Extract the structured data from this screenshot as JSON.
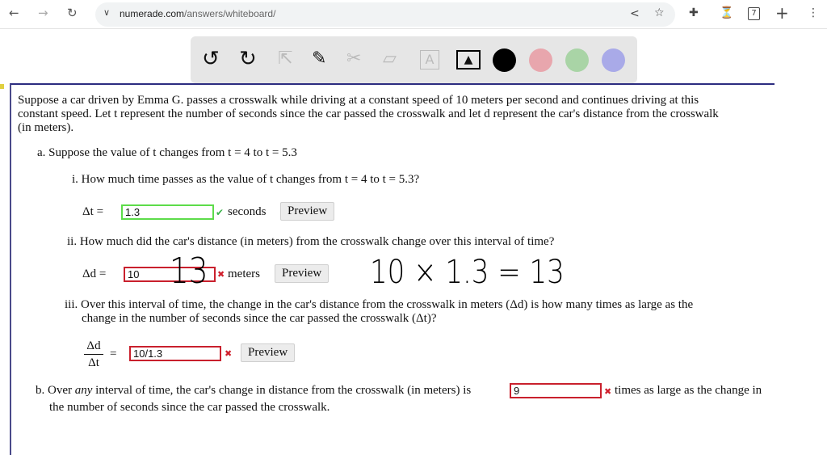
{
  "browser": {
    "url_domain": "numerade.com",
    "url_path": "/answers/whiteboard/",
    "tab_count": "7"
  },
  "toolbar": {
    "tools": [
      "undo-icon",
      "redo-icon",
      "pointer-icon",
      "pen-icon",
      "tools-icon",
      "eraser-icon",
      "text-icon",
      "image-icon"
    ],
    "colors": [
      "#000000",
      "#e8a6ad",
      "#a9d4a6",
      "#a9aae8"
    ]
  },
  "question": {
    "intro": [
      "Suppose a car driven by Emma G. passes a crosswalk while driving at a constant speed of 10 meters per second and continues driving at this",
      "constant speed. Let t represent the number of seconds since the car passed the crosswalk and let d represent the car's distance from the crosswalk",
      "(in meters)."
    ],
    "a": "a. Suppose the value of t changes from t = 4 to t = 5.3",
    "i": "i. How much time passes as the value of t changes from t = 4 to t = 5.3?",
    "i_label": "Δt =",
    "i_value": "1.3",
    "i_unit": "seconds",
    "ii": "ii. How much did the car's distance (in meters) from the crosswalk change over this interval of time?",
    "ii_label": "Δd =",
    "ii_value": "10",
    "ii_unit": "meters",
    "iii": [
      "iii. Over this interval of time, the change in the car's distance from the crosswalk in meters (Δd) is how many times as large as the",
      "change in the number of seconds since the car passed the crosswalk (Δt)?"
    ],
    "iii_num": "Δd",
    "iii_den": "Δt",
    "iii_eq": "=",
    "iii_value": "10/1.3",
    "b_pre": "b. Over",
    "b_any": "any",
    "b_mid": "interval of time, the car's change in distance from the crosswalk (in meters) is",
    "b_value": "9",
    "b_post": "times as large as the change in",
    "b_line2": "the number of seconds since the car passed the crosswalk.",
    "preview": "Preview"
  },
  "handwriting": {
    "answer": "13",
    "work": "10 × 1.3 = 13"
  }
}
